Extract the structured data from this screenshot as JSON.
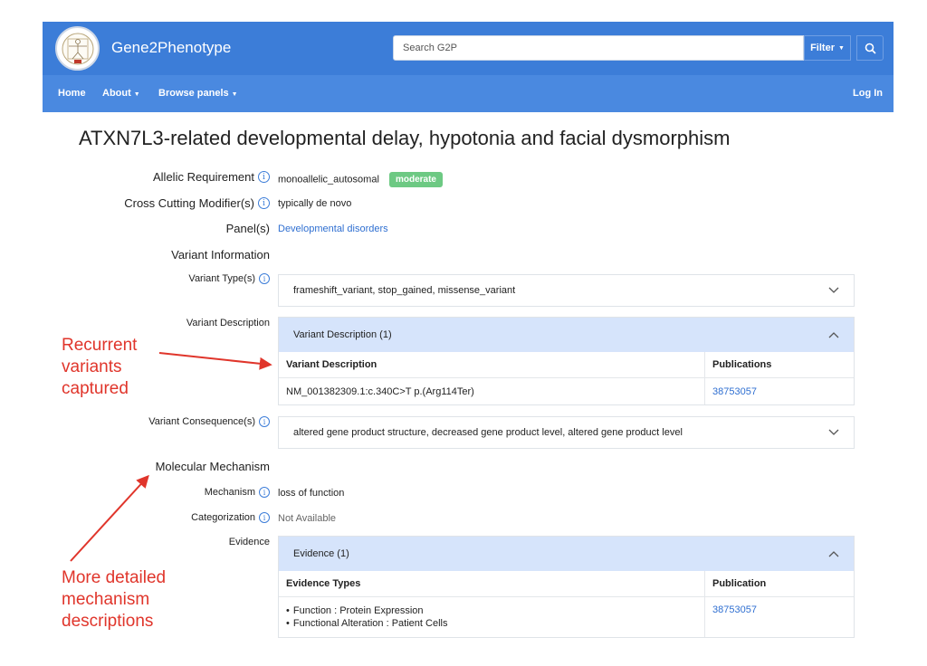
{
  "header": {
    "brand": "Gene2Phenotype",
    "search_placeholder": "Search G2P",
    "filter_label": "Filter",
    "search_icon": "search-icon"
  },
  "nav": {
    "home": "Home",
    "about": "About",
    "browse": "Browse panels",
    "login": "Log In"
  },
  "page": {
    "title": "ATXN7L3-related developmental delay, hypotonia and facial dysmorphism"
  },
  "fields": {
    "allelic_label": "Allelic Requirement",
    "allelic_value": "monoallelic_autosomal",
    "confidence_badge": "moderate",
    "ccm_label": "Cross Cutting Modifier(s)",
    "ccm_value": "typically de novo",
    "panel_label": "Panel(s)",
    "panel_value": "Developmental disorders",
    "variant_info_label": "Variant Information",
    "variant_types_label": "Variant Type(s)",
    "variant_types_value": "frameshift_variant, stop_gained, missense_variant",
    "variant_desc_label": "Variant Description",
    "variant_desc_accordion": "Variant Description (1)",
    "variant_desc_col1": "Variant Description",
    "variant_desc_col2": "Publications",
    "variant_desc_row": "NM_001382309.1:c.340C>T p.(Arg114Ter)",
    "variant_desc_pub": "38753057",
    "variant_cons_label": "Variant Consequence(s)",
    "variant_cons_value": "altered gene product structure, decreased gene product level, altered gene product level",
    "mol_mech_label": "Molecular Mechanism",
    "mechanism_label": "Mechanism",
    "mechanism_value": "loss of function",
    "categorization_label": "Categorization",
    "categorization_value": "Not Available",
    "evidence_label": "Evidence",
    "evidence_accordion": "Evidence (1)",
    "evidence_col1": "Evidence Types",
    "evidence_col2": "Publication",
    "evidence_items": [
      "Function : Protein Expression",
      "Functional Alteration : Patient Cells"
    ],
    "evidence_pub": "38753057"
  },
  "annotations": {
    "recurrent": [
      "Recurrent",
      "variants",
      "captured"
    ],
    "mechanism": [
      "More detailed",
      "mechanism",
      "descriptions"
    ],
    "color": "#e0352b"
  },
  "colors": {
    "header_bg": "#3c7dd8",
    "nav_bg": "#4a89e0",
    "badge_bg": "#6dc983",
    "accordion_bg": "#d6e4fb",
    "link": "#2f6fd1"
  }
}
